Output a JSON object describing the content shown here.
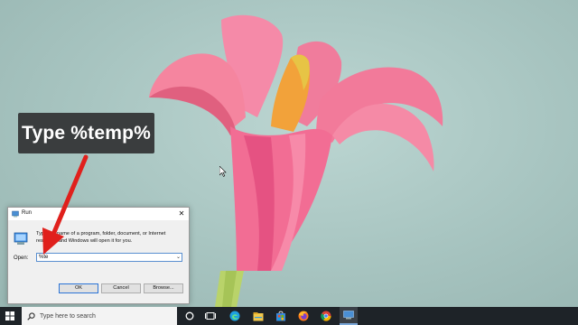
{
  "annotation": {
    "callout_text": "Type %temp%",
    "arrow_color": "#e0201c"
  },
  "run_dialog": {
    "title": "Run",
    "close_glyph": "✕",
    "description": "Type the name of a program, folder, document, or Internet resource, and Windows will open it for you.",
    "open_label": "Open:",
    "input_value": "%te",
    "dropdown_glyph": "⌄",
    "ok_label": "OK",
    "cancel_label": "Cancel",
    "browse_label": "Browse..."
  },
  "taskbar": {
    "search_placeholder": "Type here to search",
    "icons": [
      "windows-start-icon",
      "search-icon",
      "cortana-circle-icon",
      "task-view-icon",
      "edge-icon",
      "file-explorer-icon",
      "store-icon",
      "firefox-icon",
      "chrome-icon",
      "run-icon"
    ]
  },
  "colors": {
    "taskbar": "#1e2328",
    "wallpaper": "#a9c6c2",
    "petal": "#f07395",
    "accent": "#2a73d6"
  }
}
